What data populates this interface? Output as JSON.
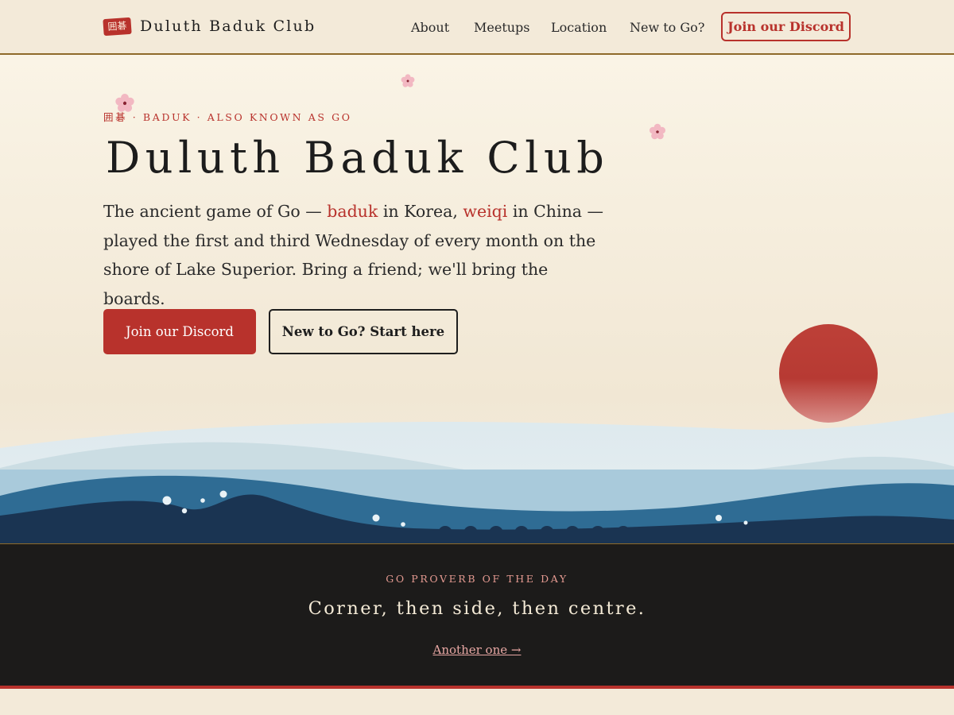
{
  "header": {
    "logo_seal": "囲碁",
    "site_name": "Duluth Baduk Club",
    "nav": [
      {
        "label": "About"
      },
      {
        "label": "Meetups"
      },
      {
        "label": "Location"
      },
      {
        "label": "New to Go?"
      }
    ],
    "cta_label": "Join our Discord"
  },
  "hero": {
    "eyebrow": "囲碁 · BADUK · ALSO KNOWN AS GO",
    "title": "Duluth Baduk Club",
    "lead": {
      "part1": "The ancient game of Go — ",
      "term_korea": "baduk",
      "part2": " in Korea, ",
      "term_china": "weiqi",
      "part3": " in China — played the first and third Wednesday of every month on the shore of Lake Superior. Bring a friend; we'll bring the boards."
    },
    "primary_button": "Join our Discord",
    "secondary_button": "New to Go? Start here"
  },
  "proverb": {
    "label": "GO PROVERB OF THE DAY",
    "text": "Corner, then side, then centre.",
    "link": "Another one →"
  },
  "colors": {
    "accent": "#b8322c",
    "background": "#f3ead9",
    "dark_band": "#1c1b1a",
    "gold_rule": "#8e6a2a",
    "wave_navy": "#1a3452",
    "wave_blue": "#2f6c94",
    "wave_light": "#a9cadb"
  },
  "icons": [
    "cherry-blossom-icon",
    "rising-sun",
    "ocean-waves"
  ]
}
